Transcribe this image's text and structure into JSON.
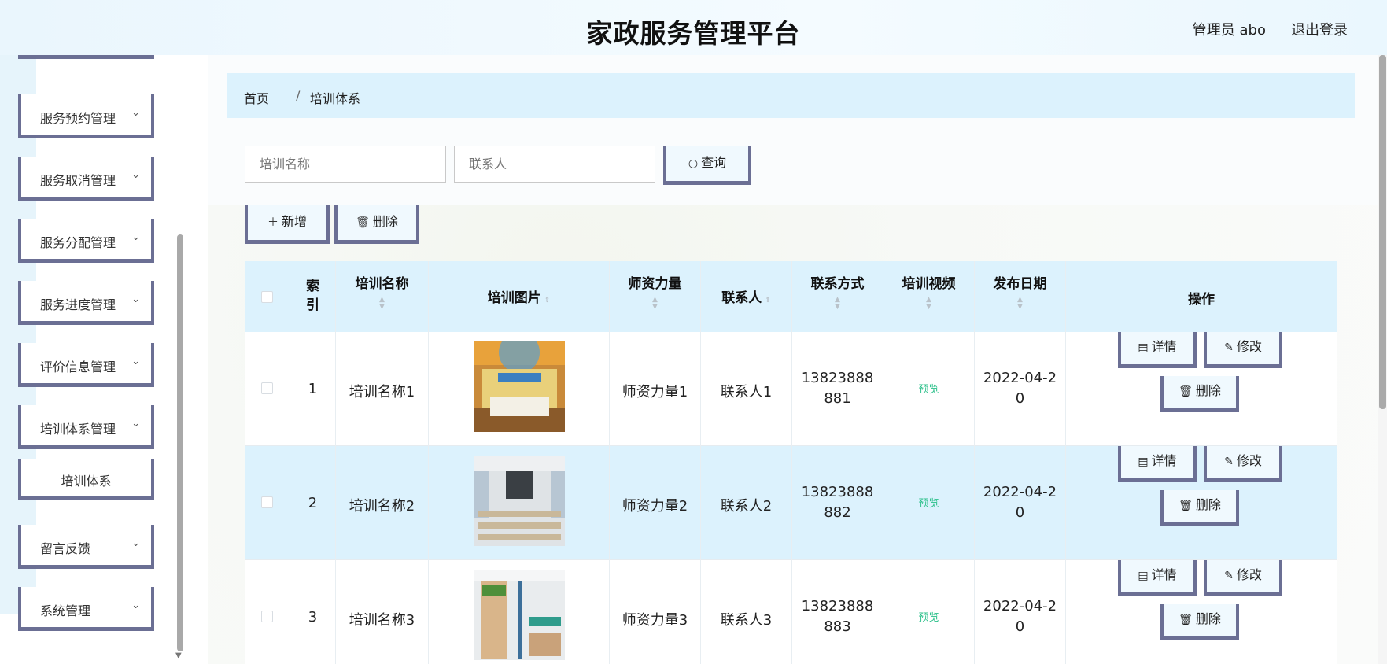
{
  "header": {
    "title": "家政服务管理平台",
    "user": "管理员 abo",
    "logout": "退出登录"
  },
  "sidebar": {
    "items": [
      {
        "label": "服务预约管理"
      },
      {
        "label": "服务取消管理"
      },
      {
        "label": "服务分配管理"
      },
      {
        "label": "服务进度管理"
      },
      {
        "label": "评价信息管理"
      },
      {
        "label": "培训体系管理"
      },
      {
        "label": "培训体系"
      },
      {
        "label": "留言反馈"
      },
      {
        "label": "系统管理"
      }
    ]
  },
  "breadcrumb": {
    "home": "首页",
    "sep": "/",
    "current": "培训体系"
  },
  "search": {
    "name_placeholder": "培训名称",
    "contact_placeholder": "联系人",
    "query_label": "查询"
  },
  "actions": {
    "add_label": "新增",
    "delete_label": "删除"
  },
  "table": {
    "headers": {
      "index": "索引",
      "name": "培训名称",
      "image": "培训图片",
      "faculty": "师资力量",
      "contact": "联系人",
      "phone": "联系方式",
      "video": "培训视频",
      "date": "发布日期",
      "ops": "操作"
    },
    "rows": [
      {
        "index": "1",
        "name": "培训名称1",
        "faculty": "师资力量1",
        "contact": "联系人1",
        "phone_a": "13823888",
        "phone_b": "881",
        "video": "预览",
        "date_a": "2022-04-2",
        "date_b": "0"
      },
      {
        "index": "2",
        "name": "培训名称2",
        "faculty": "师资力量2",
        "contact": "联系人2",
        "phone_a": "13823888",
        "phone_b": "882",
        "video": "预览",
        "date_a": "2022-04-2",
        "date_b": "0"
      },
      {
        "index": "3",
        "name": "培训名称3",
        "faculty": "师资力量3",
        "contact": "联系人3",
        "phone_a": "13823888",
        "phone_b": "883",
        "video": "预览",
        "date_a": "2022-04-2",
        "date_b": "0"
      }
    ],
    "ops": {
      "detail": "详情",
      "edit": "修改",
      "delete": "删除"
    }
  },
  "colors": {
    "accent_border": "#6b6f94",
    "header_bg": "#dcf2fd",
    "preview_green": "#2bc08a"
  }
}
